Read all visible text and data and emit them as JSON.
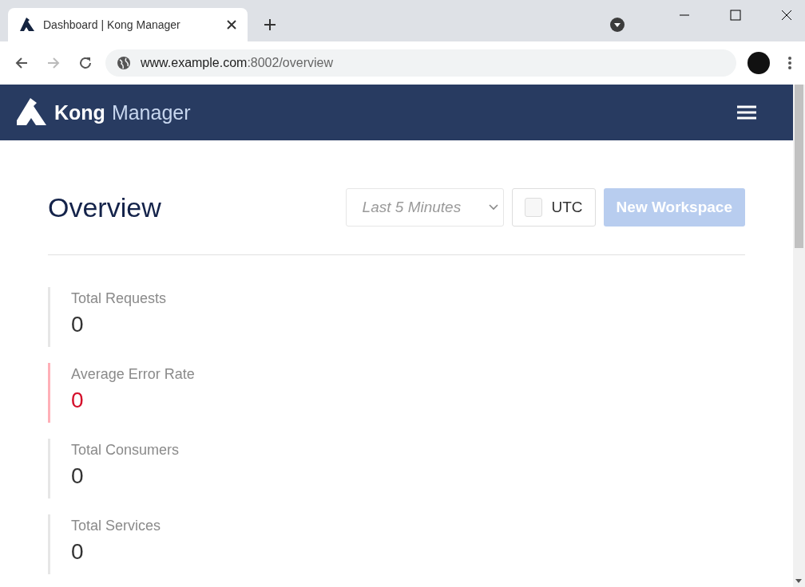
{
  "browser": {
    "tab_title": "Dashboard | Kong Manager",
    "url_host": "www.example.com",
    "url_path": ":8002/overview",
    "forward_disabled": true
  },
  "header": {
    "brand_bold": "Kong",
    "brand_light": "Manager"
  },
  "page": {
    "title": "Overview",
    "time_select": {
      "value": "Last 5 Minutes",
      "disabled": true
    },
    "utc": {
      "label": "UTC",
      "checked": false
    },
    "new_workspace": {
      "label": "New Workspace",
      "disabled": true
    }
  },
  "stats": [
    {
      "label": "Total Requests",
      "value": "0",
      "kind": "normal"
    },
    {
      "label": "Average Error Rate",
      "value": "0",
      "kind": "error"
    },
    {
      "label": "Total Consumers",
      "value": "0",
      "kind": "normal"
    },
    {
      "label": "Total Services",
      "value": "0",
      "kind": "normal"
    }
  ]
}
